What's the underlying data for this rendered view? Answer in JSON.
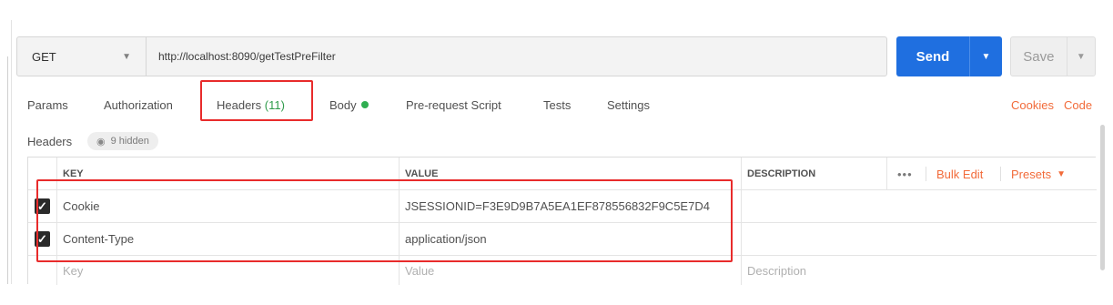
{
  "request": {
    "method": "GET",
    "url": "http://localhost:8090/getTestPreFilter",
    "send_label": "Send",
    "save_label": "Save"
  },
  "tabs": [
    {
      "label": "Params"
    },
    {
      "label": "Authorization"
    },
    {
      "label": "Headers",
      "count": "(11)",
      "active": true
    },
    {
      "label": "Body",
      "has_dot": true
    },
    {
      "label": "Pre-request Script"
    },
    {
      "label": "Tests"
    },
    {
      "label": "Settings"
    }
  ],
  "right_links": {
    "cookies": "Cookies",
    "code": "Code"
  },
  "headers_section": {
    "title": "Headers",
    "hidden": "9 hidden"
  },
  "table": {
    "columns": {
      "key": "KEY",
      "value": "VALUE",
      "description": "DESCRIPTION"
    },
    "tools": {
      "more": "•••",
      "bulk_edit": "Bulk Edit",
      "presets": "Presets"
    },
    "rows": [
      {
        "key": "Cookie",
        "value": "JSESSIONID=F3E9D9B7A5EA1EF878556832F9C5E7D4",
        "description": "",
        "checked": true
      },
      {
        "key": "Content-Type",
        "value": "application/json",
        "description": "",
        "checked": true
      }
    ],
    "new_row": {
      "key_placeholder": "Key",
      "value_placeholder": "Value",
      "description_placeholder": "Description"
    }
  },
  "colors": {
    "send": "#1f6fe0",
    "accent_link": "#f26b3a",
    "highlight": "#e82b2b",
    "count": "#2f9b4b"
  },
  "icons": {
    "checkbox": "check-icon",
    "eye": "eye-icon",
    "dropdown": "chevron-down-icon"
  }
}
